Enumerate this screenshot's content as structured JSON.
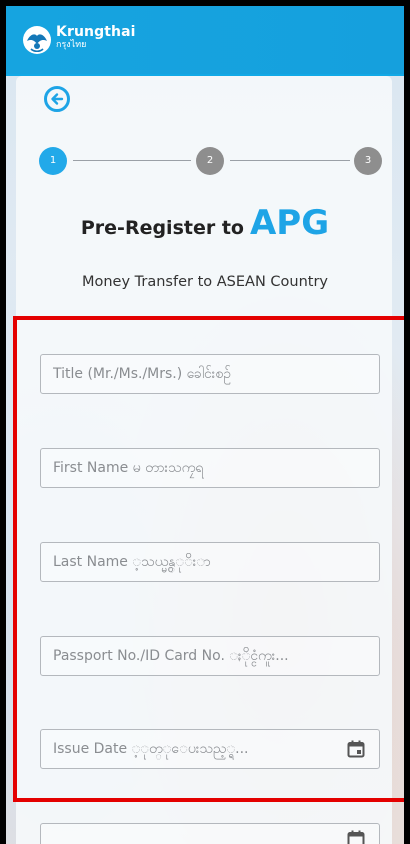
{
  "header": {
    "brand_name": "Krungthai",
    "brand_sub": "กรุงไทย",
    "bar_color": "#16a4e0"
  },
  "stepper": {
    "steps": [
      "1",
      "2",
      "3"
    ],
    "active": "1",
    "active_color": "#22a9e9",
    "inactive_color": "#8e8e8e"
  },
  "page": {
    "title_prefix": "Pre-Register to",
    "title_highlight": "APG",
    "subtitle": "Money Transfer to ASEAN Country",
    "accent_color": "#1ea4e6"
  },
  "form": {
    "title_placeholder": "Title (Mr./Ms./Mrs.) ခေါင်းစဉ်",
    "first_name_placeholder": "First Name မ တားသကၠရ",
    "last_name_placeholder": "Last Name ့သယ္မွန္ုိးာ",
    "passport_placeholder": "Passport No./ID Card No. ႏိုင္ငံကူး...",
    "issue_date_placeholder": "Issue Date ့ုတ္ုေပးသည့္ရ..."
  },
  "icons": {
    "back": "arrow-left-circle-icon",
    "calendar": "calendar-icon",
    "logo": "krungthai-bird-logo"
  },
  "highlight_color": "#e40000"
}
